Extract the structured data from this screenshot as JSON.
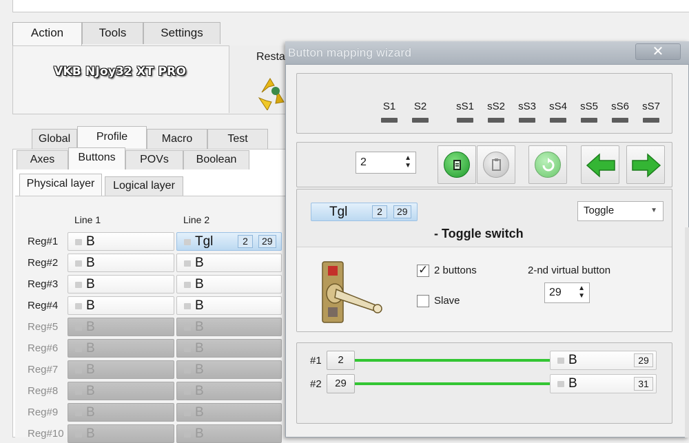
{
  "main_window": {
    "top_tabs": [
      "Action",
      "Tools",
      "Settings"
    ],
    "device_name": "VKB NJoy32 XT PRO",
    "restore_label": "Resta",
    "config_tabs": [
      "Global",
      "Profile",
      "Macro",
      "Test"
    ],
    "profile_tabs": [
      "Axes",
      "Buttons",
      "POVs",
      "Boolean"
    ],
    "layer_tabs": [
      "Physical layer",
      "Logical layer"
    ],
    "columns": [
      "Line 1",
      "Line 2"
    ],
    "rows": [
      {
        "label": "Reg#1",
        "line1": "B",
        "line2": "Tgl",
        "line2_nums": [
          "2",
          "29"
        ],
        "enabled": true
      },
      {
        "label": "Reg#2",
        "line1": "B",
        "line2": "B",
        "enabled": true
      },
      {
        "label": "Reg#3",
        "line1": "B",
        "line2": "B",
        "enabled": true
      },
      {
        "label": "Reg#4",
        "line1": "B",
        "line2": "B",
        "enabled": true
      },
      {
        "label": "Reg#5",
        "line1": "B",
        "line2": "B",
        "enabled": false
      },
      {
        "label": "Reg#6",
        "line1": "B",
        "line2": "B",
        "enabled": false
      },
      {
        "label": "Reg#7",
        "line1": "B",
        "line2": "B",
        "enabled": false
      },
      {
        "label": "Reg#8",
        "line1": "B",
        "line2": "B",
        "enabled": false
      },
      {
        "label": "Reg#9",
        "line1": "B",
        "line2": "B",
        "enabled": false
      },
      {
        "label": "Reg#10",
        "line1": "B",
        "line2": "B",
        "enabled": false
      }
    ]
  },
  "dialog": {
    "title": "Button mapping wizard",
    "close_glyph": "✕",
    "switches": [
      "S1",
      "S2",
      "sS1",
      "sS2",
      "sS3",
      "sS4",
      "sS5",
      "sS6",
      "sS7"
    ],
    "button_number": "2",
    "spin_glyph": "▲▼",
    "mode_cell": {
      "text": "Tgl",
      "nums": [
        "2",
        "29"
      ]
    },
    "mode_select": {
      "value": "Toggle",
      "arrow": "▼"
    },
    "mode_description": "- Toggle switch",
    "options": {
      "two_buttons_label": "2 buttons",
      "two_buttons_checked": true,
      "check_glyph": "✓",
      "slave_label": "Slave",
      "slave_checked": false,
      "second_button_label": "2-nd virtual button",
      "second_button_value": "29"
    },
    "mappings": [
      {
        "label": "#1",
        "source": "2",
        "target_text": "B",
        "target_num": "29"
      },
      {
        "label": "#2",
        "source": "29",
        "target_text": "B",
        "target_num": "31"
      }
    ]
  }
}
